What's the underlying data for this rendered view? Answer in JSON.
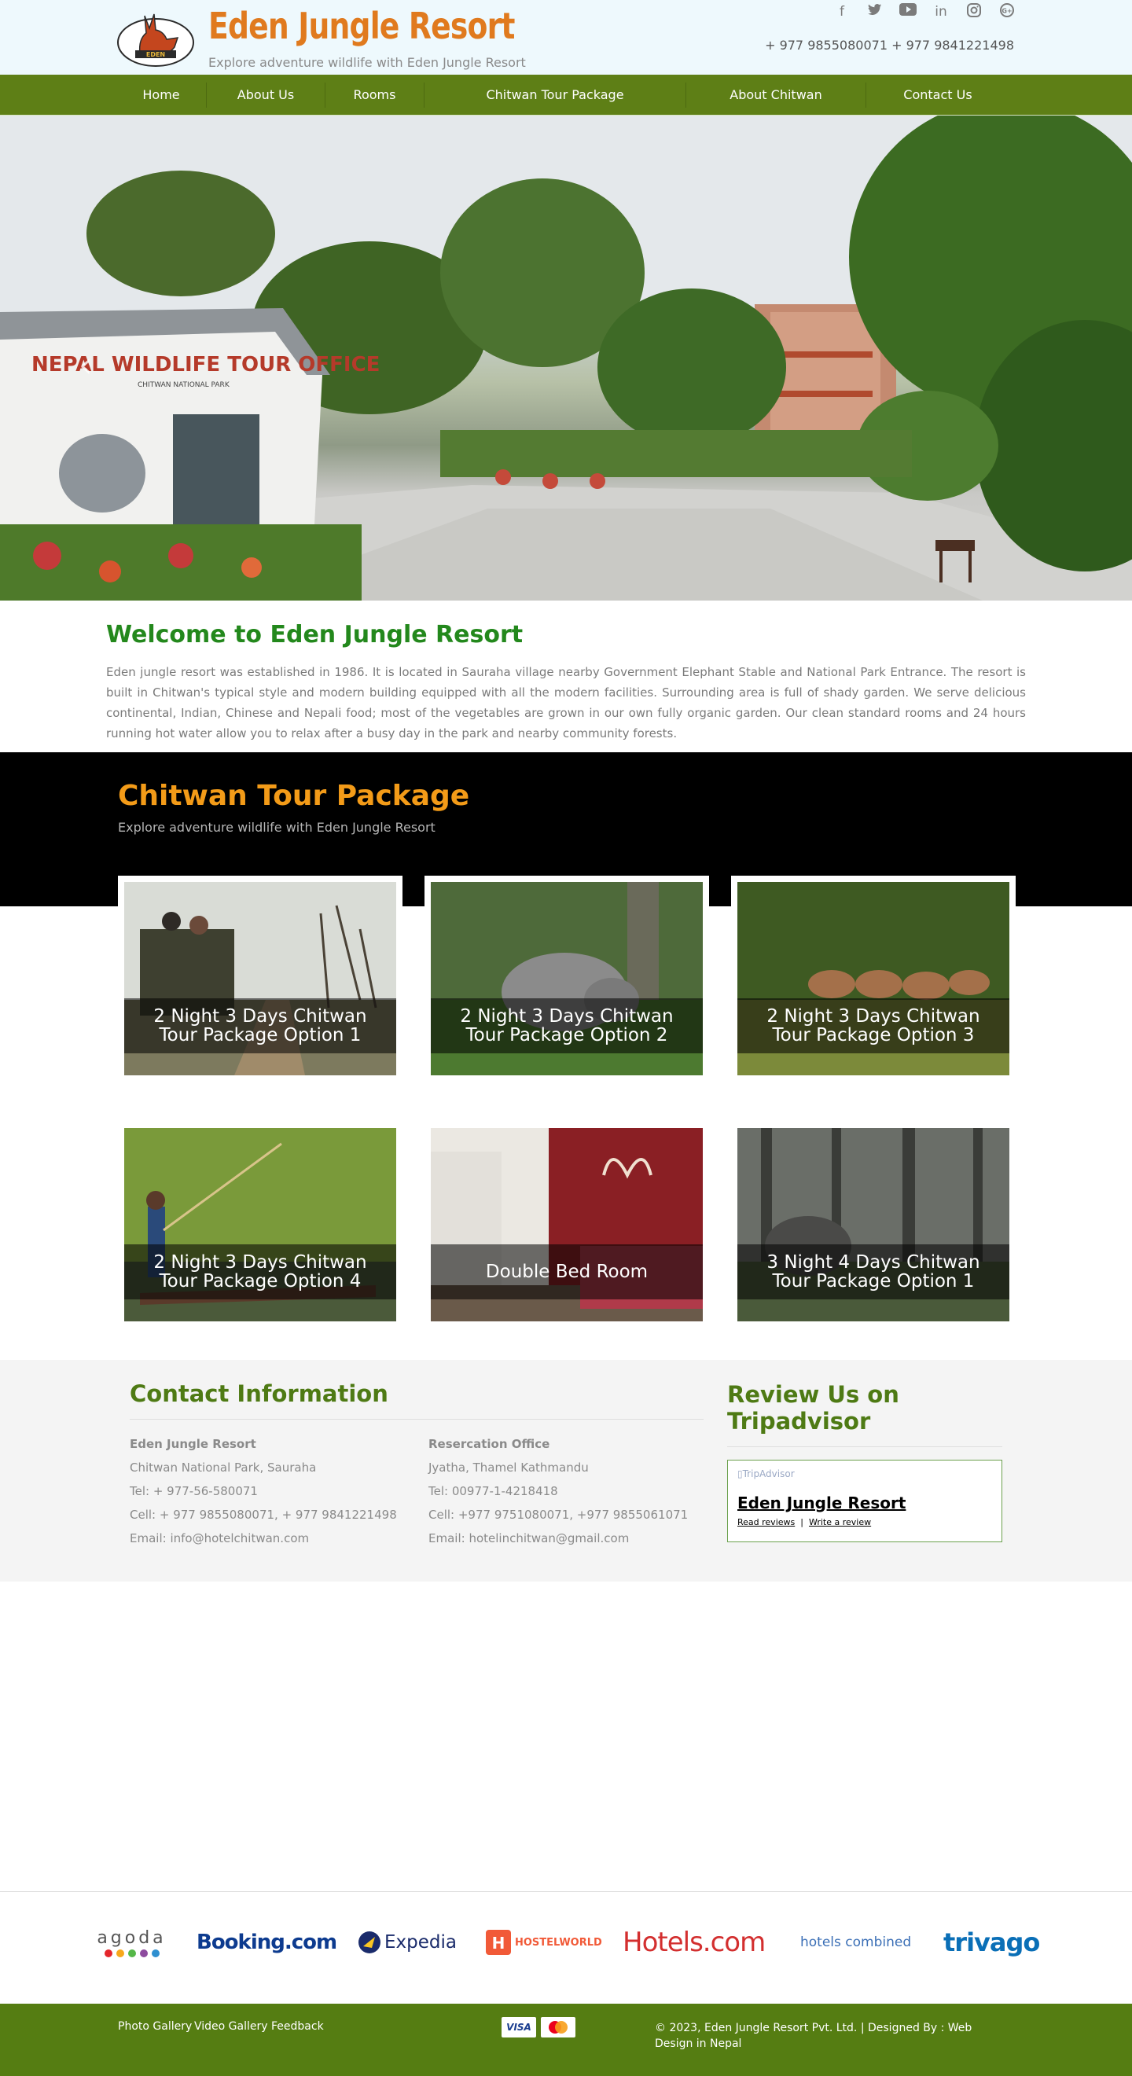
{
  "header": {
    "brand_title": "Eden Jungle Resort",
    "tagline": "Explore adventure wildlife with Eden Jungle Resort",
    "phones": "+ 977 9855080071 + 977 9841221498",
    "social_icons": [
      "facebook-icon",
      "twitter-icon",
      "youtube-icon",
      "linkedin-icon",
      "instagram-icon",
      "google-plus-icon"
    ]
  },
  "nav": {
    "items": [
      {
        "label": "Home"
      },
      {
        "label": "About Us"
      },
      {
        "label": "Rooms"
      },
      {
        "label": "Chitwan Tour Package"
      },
      {
        "label": "About Chitwan"
      },
      {
        "label": "Contact Us"
      }
    ]
  },
  "hero": {
    "sign_text": "NEPAL WILDLIFE TOUR OFFICE",
    "sign_sub": "CHITWAN NATIONAL PARK"
  },
  "welcome": {
    "title": "Welcome to Eden Jungle Resort",
    "text": "Eden jungle resort was established in 1986. It is located in Sauraha village nearby Government Elephant Stable and National Park Entrance. The resort is built in Chitwan's typical style and modern building equipped with all the modern facilities. Surrounding area is full of shady garden. We serve delicious continental, Indian, Chinese and Nepali food; most of the vegetables are grown in our own fully organic garden. Our clean standard rooms and 24 hours running hot water allow you to relax after a busy day in the park and nearby community forests."
  },
  "tours": {
    "title": "Chitwan Tour Package",
    "subtitle": "Explore adventure wildlife with Eden Jungle Resort",
    "cards": [
      {
        "caption": "2 Night 3 Days Chitwan Tour Package Option 1"
      },
      {
        "caption": "2 Night 3 Days Chitwan Tour Package Option 2"
      },
      {
        "caption": "2 Night 3 Days Chitwan Tour Package Option 3"
      },
      {
        "caption": "2 Night 3 Days Chitwan Tour Package Option 4"
      },
      {
        "caption": "Double Bed Room"
      },
      {
        "caption": "3 Night 4 Days Chitwan Tour Package Option 1"
      }
    ]
  },
  "contact": {
    "title": "Contact Information",
    "resort": {
      "name": "Eden Jungle Resort",
      "address": "Chitwan National Park, Sauraha",
      "tel": "Tel: + 977-56-580071",
      "cell": "Cell: + 977 9855080071, + 977 9841221498",
      "email": "Email: info@hotelchitwan.com"
    },
    "office": {
      "name": "Resercation Office",
      "address": "Jyatha, Thamel Kathmandu",
      "tel": "Tel: 00977-1-4218418",
      "cell": "Cell: +977 9751080071, +977 9855061071",
      "email": "Email: hotelinchitwan@gmail.com"
    }
  },
  "review": {
    "title": "Review Us on Tripadvisor",
    "img_alt": "TripAdvisor",
    "name": "Eden Jungle Resort",
    "read": "Read reviews",
    "sep": "|",
    "write": "Write a review"
  },
  "partners": [
    "agoda",
    "Booking.com",
    "Expedia",
    "HOSTELWORLD",
    "Hotels.com",
    "hotels combined",
    "trivago"
  ],
  "footer": {
    "links": [
      "Photo Gallery",
      "Video Gallery",
      "Feedback"
    ],
    "payments": [
      "VISA",
      "MasterCard"
    ],
    "copyright": "© 2023, Eden Jungle Resort Pvt. Ltd. | Designed By : Web Design in Nepal"
  },
  "colors": {
    "brand_orange": "#e07a1e",
    "nav_green": "#5e7f16",
    "welcome_green": "#23881c",
    "tour_orange": "#f39b18",
    "contact_green": "#4e7a14",
    "footer_green": "#557d12"
  }
}
